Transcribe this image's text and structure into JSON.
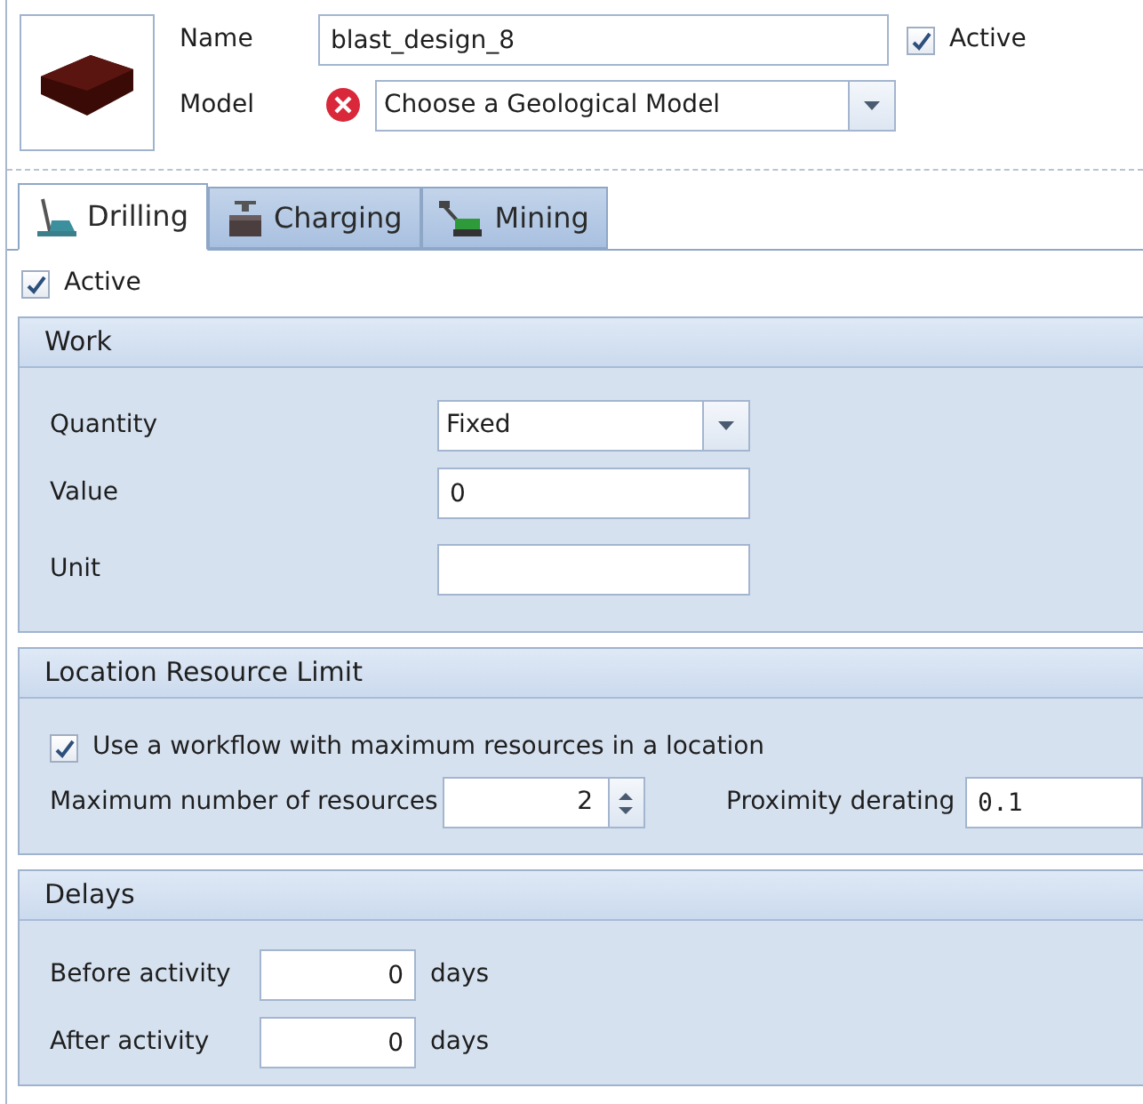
{
  "header": {
    "name_label": "Name",
    "name_value": "blast_design_8",
    "active": {
      "label": "Active",
      "checked": true
    },
    "model_label": "Model",
    "model_value": "Choose a Geological Model",
    "model_error": true
  },
  "tabs": [
    {
      "label": "Drilling",
      "kind": "drilling",
      "selected": true
    },
    {
      "label": "Charging",
      "kind": "charging",
      "selected": false
    },
    {
      "label": "Mining",
      "kind": "mining",
      "selected": false
    }
  ],
  "tab_active": {
    "label": "Active",
    "checked": true
  },
  "work": {
    "title": "Work",
    "rows": [
      {
        "kind": "dropdown",
        "label": "Quantity",
        "value": "Fixed"
      },
      {
        "kind": "text",
        "label": "Value",
        "value": "0"
      },
      {
        "kind": "text",
        "label": "Unit"
      }
    ]
  },
  "location_resource_limit": {
    "title": "Location Resource Limit",
    "use_workflow": {
      "label": "Use a workflow with maximum resources in a location",
      "checked": true
    },
    "max_label": "Maximum number of resources",
    "max_value": "2",
    "proximity_label": "Proximity derating",
    "proximity_value": "0.1"
  },
  "delays": {
    "title": "Delays",
    "rows": [
      {
        "label": "Before activity",
        "value": "0",
        "unit": "days"
      },
      {
        "label": "After activity",
        "value": "0",
        "unit": "days"
      }
    ]
  }
}
